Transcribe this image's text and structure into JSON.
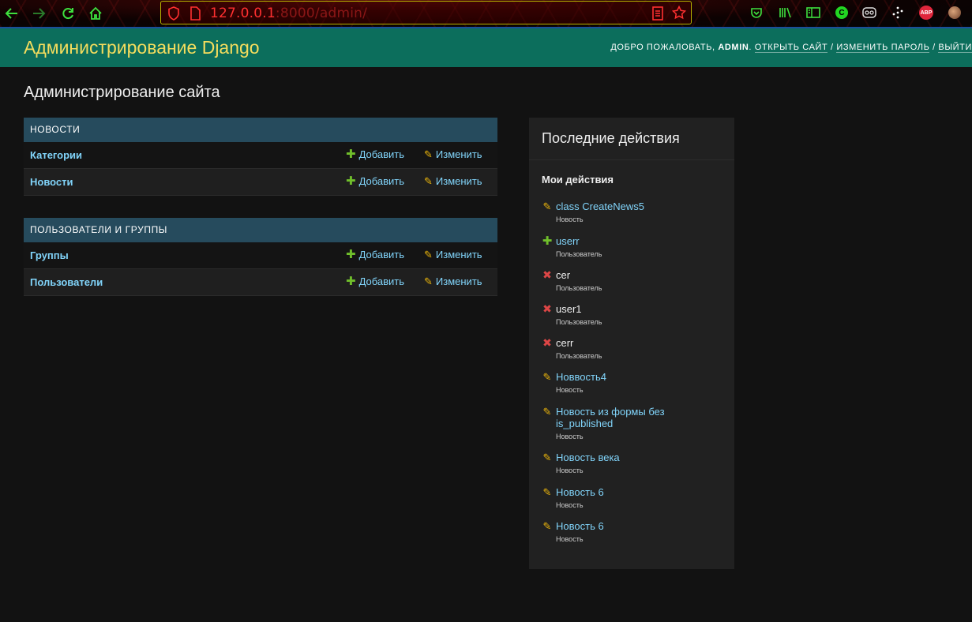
{
  "browser": {
    "url_host": "127.0.0.1",
    "url_rest": ":8000/admin/",
    "extension_abp": "ABP",
    "extension_c": "C"
  },
  "header": {
    "branding": "Администрирование Django",
    "welcome": "ДОБРО ПОЖАЛОВАТЬ,",
    "username": "ADMIN",
    "view_site": "ОТКРЫТЬ САЙТ",
    "change_password": "ИЗМЕНИТЬ ПАРОЛЬ",
    "logout": "ВЫЙТИ",
    "separator": "/"
  },
  "content": {
    "title": "Администрирование сайта",
    "add_label": "Добавить",
    "change_label": "Изменить",
    "apps": [
      {
        "caption": "Новости",
        "models": [
          {
            "name": "Категории"
          },
          {
            "name": "Новости"
          }
        ]
      },
      {
        "caption": "Пользователи и группы",
        "models": [
          {
            "name": "Группы"
          },
          {
            "name": "Пользователи"
          }
        ]
      }
    ]
  },
  "recent_actions": {
    "title": "Последние действия",
    "subtitle": "Мои действия",
    "items": [
      {
        "type": "change",
        "object": "class CreateNews5",
        "content_type": "Новость",
        "link": true
      },
      {
        "type": "add",
        "object": "userr",
        "content_type": "Пользователь",
        "link": true
      },
      {
        "type": "delete",
        "object": "cer",
        "content_type": "Пользователь",
        "link": false
      },
      {
        "type": "delete",
        "object": "user1",
        "content_type": "Пользователь",
        "link": false
      },
      {
        "type": "delete",
        "object": "cerr",
        "content_type": "Пользователь",
        "link": false
      },
      {
        "type": "change",
        "object": "Новвость4",
        "content_type": "Новость",
        "link": true
      },
      {
        "type": "change",
        "object": "Новость из формы без is_published",
        "content_type": "Новость",
        "link": true
      },
      {
        "type": "change",
        "object": "Новость века",
        "content_type": "Новость",
        "link": true
      },
      {
        "type": "change",
        "object": "Новость 6",
        "content_type": "Новость",
        "link": true
      },
      {
        "type": "change",
        "object": "Новость 6",
        "content_type": "Новость",
        "link": true
      }
    ]
  },
  "colors": {
    "header_bg": "#0c6e5c",
    "branding": "#f5dd5d",
    "module_caption_bg": "#264b5d",
    "link": "#81d4fa",
    "add_icon": "#70bf2b",
    "change_icon": "#efb80b",
    "delete_icon": "#dd4646"
  }
}
